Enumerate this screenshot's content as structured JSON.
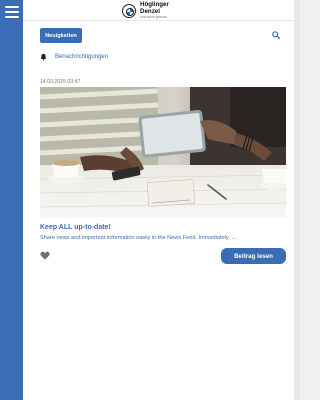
{
  "brand": {
    "name_line1": "Höglinger",
    "name_line2": "Denzel",
    "tagline": "und seine genuss...",
    "mark_icon": "bmw-roundel-icon"
  },
  "sidebar": {
    "menu_icon": "hamburger-menu-icon",
    "color": "#3a6db5"
  },
  "toolbar": {
    "news_button_label": "Neuigkeiten",
    "search_icon": "search-icon"
  },
  "notifications": {
    "icon": "bell-icon",
    "label": "Benachrichtigungen"
  },
  "post": {
    "timestamp": "14.03.2025 03:47",
    "image_icon": "people-with-tablet-photo",
    "title": "Keep ALL up-to-date!",
    "excerpt": "Share news and important information easily in the News Feed. Immediately, ...",
    "like_icon": "heart-icon",
    "read_button_label": "Beitrag lesen"
  },
  "colors": {
    "accent": "#3a6db5",
    "background": "#ffffff",
    "page_bg": "#f0f1f3"
  }
}
